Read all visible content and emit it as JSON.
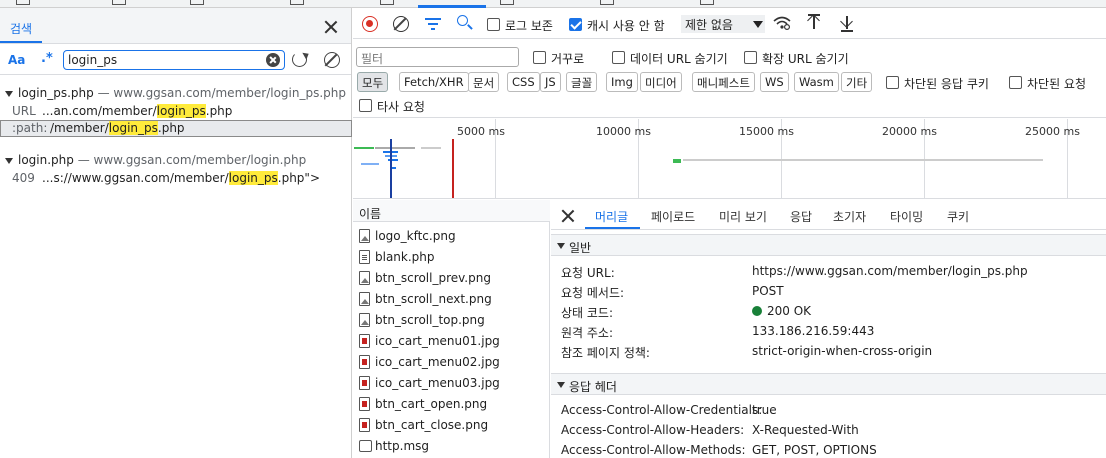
{
  "search": {
    "tab": "검색",
    "case_label": "Aa",
    "regex_label": ".*",
    "query": "login_ps",
    "results": [
      {
        "file": "login_ps.php",
        "sep": " — ",
        "url": "www.ggsan.com/member/login_ps.php",
        "lines": [
          {
            "label": "URL",
            "pre": "...an.com/member/",
            "hit": "login_ps",
            "post": ".php"
          },
          {
            "label": ":path:",
            "pre": "/member/",
            "hit": "login_ps",
            "post": ".php"
          }
        ]
      },
      {
        "file": "login.php",
        "sep": " — ",
        "url": "www.ggsan.com/member/login.php",
        "lines": [
          {
            "label": "409",
            "pre": "...s://www.ggsan.com/member/",
            "hit": "login_ps",
            "post": ".php\">"
          }
        ]
      }
    ]
  },
  "toolbar": {
    "preserve_log": "로그 보존",
    "disable_cache": "캐시 사용 안 함",
    "throttle": "제한 없음"
  },
  "filter": {
    "placeholder": "필터",
    "invert": "거꾸로",
    "hide_data_urls": "데이터 URL 숨기기",
    "hide_ext_urls": "확장 URL 숨기기",
    "types": [
      "모두",
      "Fetch/XHR",
      "문서",
      "CSS",
      "JS",
      "글꼴",
      "Img",
      "미디어",
      "매니페스트",
      "WS",
      "Wasm",
      "기타"
    ],
    "blocked_cookies": "차단된 응답 쿠키",
    "blocked_requests": "차단된 요청",
    "third_party": "타사 요청"
  },
  "timeline": {
    "ticks": [
      "5000 ms",
      "10000 ms",
      "15000 ms",
      "20000 ms",
      "25000 ms"
    ]
  },
  "requests": {
    "header": "이름",
    "items": [
      {
        "name": "logo_kftc.png",
        "icon": "image-file-icon"
      },
      {
        "name": "blank.php",
        "icon": "document-icon"
      },
      {
        "name": "btn_scroll_prev.png",
        "icon": "image-file-icon"
      },
      {
        "name": "btn_scroll_next.png",
        "icon": "image-file-icon"
      },
      {
        "name": "btn_scroll_top.png",
        "icon": "image-file-icon"
      },
      {
        "name": "ico_cart_menu01.jpg",
        "icon": "image-file-icon"
      },
      {
        "name": "ico_cart_menu02.jpg",
        "icon": "image-file-icon"
      },
      {
        "name": "ico_cart_menu03.jpg",
        "icon": "image-file-icon"
      },
      {
        "name": "btn_cart_open.png",
        "icon": "image-file-icon"
      },
      {
        "name": "btn_cart_close.png",
        "icon": "image-file-icon"
      },
      {
        "name": "http.msg",
        "icon": "message-icon"
      }
    ]
  },
  "details": {
    "tabs": [
      "머리글",
      "페이로드",
      "미리 보기",
      "응답",
      "초기자",
      "타이밍",
      "쿠키"
    ],
    "general": {
      "title": "일반",
      "rows": [
        {
          "k": "요청 URL:",
          "v": "https://www.ggsan.com/member/login_ps.php"
        },
        {
          "k": "요청 메서드:",
          "v": "POST"
        },
        {
          "k": "상태 코드:",
          "v": "200 OK"
        },
        {
          "k": "원격 주소:",
          "v": "133.186.216.59:443"
        },
        {
          "k": "참조 페이지 정책:",
          "v": "strict-origin-when-cross-origin"
        }
      ]
    },
    "response": {
      "title": "응답 헤더",
      "rows": [
        {
          "k": "Access-Control-Allow-Credentials:",
          "v": "true"
        },
        {
          "k": "Access-Control-Allow-Headers:",
          "v": "X-Requested-With"
        },
        {
          "k": "Access-Control-Allow-Methods:",
          "v": "GET, POST, OPTIONS"
        }
      ]
    }
  },
  "colors": {
    "accent": "#1a73e8",
    "record": "#d93025",
    "status_ok": "#188038",
    "highlight": "#ffeb3b"
  }
}
